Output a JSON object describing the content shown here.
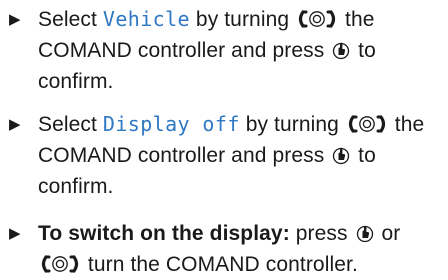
{
  "steps": [
    {
      "segments": [
        "Select ",
        "Vehicle",
        " by turning ",
        " the COMAND controller and press ",
        " to confirm."
      ],
      "display_term": "Vehicle"
    },
    {
      "segments": [
        "Select ",
        "Display off",
        " by turning ",
        " the COMAND controller and press ",
        " to confirm."
      ],
      "display_term": "Display off"
    },
    {
      "heading": "To switch on the display:",
      "segments": [
        " press ",
        " or ",
        " turn the COMAND controller."
      ]
    }
  ],
  "icons": {
    "bullet": "triangle-right-icon",
    "turn": "turn-controller-icon",
    "press": "press-controller-icon",
    "display_text_color": "#2f78c4"
  }
}
